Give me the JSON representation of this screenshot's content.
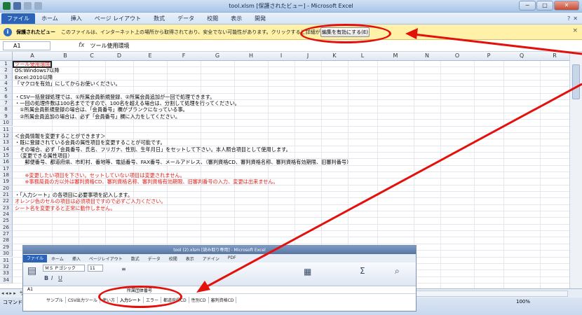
{
  "window": {
    "title": "tool.xlsm [保護されたビュー] - Microsoft Excel",
    "min": "−",
    "max": "□",
    "close": "✕"
  },
  "ribbon": {
    "file_tab": "ファイル",
    "tabs": [
      "ホーム",
      "挿入",
      "ページ レイアウト",
      "数式",
      "データ",
      "校閲",
      "表示",
      "開発"
    ],
    "help": "?",
    "ribbon_close": "✕"
  },
  "message_bar": {
    "label": "保護されたビュー",
    "text": "このファイルは、インターネット上の場所から取得されており、安全でない可能性があります。クリックすると詳細が表示されます。",
    "enable_button": "編集を有効にする(E)",
    "close": "×"
  },
  "formula_bar": {
    "name_box": "A1",
    "fx": "fx",
    "content": "ツール使用環境"
  },
  "columns": [
    "A",
    "B",
    "C",
    "D",
    "E",
    "F",
    "G",
    "H",
    "I",
    "J",
    "K",
    "L",
    "M",
    "N",
    "O",
    "P",
    "Q",
    "R"
  ],
  "rows": [
    {
      "n": "1",
      "text": "ツール使用環境",
      "red": true
    },
    {
      "n": "2",
      "text": "OS:Windows7以降",
      "red": false
    },
    {
      "n": "3",
      "text": "Excel:2010以降",
      "red": false
    },
    {
      "n": "4",
      "text": "「マクロを有効」にしてからお使いください。",
      "red": false
    },
    {
      "n": "5",
      "text": "",
      "red": false
    },
    {
      "n": "6",
      "text": "・CSV一括登録処理では、①所属会員新規登録、②所属会員追加が一回で処理できます。",
      "red": false
    },
    {
      "n": "7",
      "text": "・一回の処理件数は100名までですので、100名を超える場合は、分割して処理を行ってください。",
      "red": false
    },
    {
      "n": "8",
      "text": "　①所属会員新規登録の場合は、「会員番号」欄がブランクになっている事。",
      "red": false
    },
    {
      "n": "9",
      "text": "　②所属会員追加の場合は、必ず「会員番号」欄に入力をしてください。",
      "red": false
    },
    {
      "n": "10",
      "text": "",
      "red": false
    },
    {
      "n": "11",
      "text": "",
      "red": false
    },
    {
      "n": "12",
      "text": "＜会員情報を変更することができます＞",
      "red": false
    },
    {
      "n": "13",
      "text": "・既に登録されている会員の属性項目を変更することが可能です。",
      "red": false
    },
    {
      "n": "14",
      "text": "　その場合、必ず「会員番号、氏名、フリガナ、性別、生年月日」をセットして下さい。本人照合項目として使用します。",
      "red": false
    },
    {
      "n": "15",
      "text": "　（変更できる属性項目）",
      "red": false
    },
    {
      "n": "16",
      "text": "　　郵便番号、都道府県、市町村、番地等、電話番号、FAX番号、メールアドレス、（審判資格CD、審判資格名称、審判資格有効期限、旧審判番号）",
      "red": false
    },
    {
      "n": "17",
      "text": "",
      "red": false
    },
    {
      "n": "18",
      "text": "　　※変更したい項目を下さい。セットしていない項目は変更されません。",
      "red": true
    },
    {
      "n": "19",
      "text": "　　※事務局員の方以外は審判資格CD、審判資格名称、審判資格有効期限、旧審判番号の入力、変更は出来ません。",
      "red": true
    },
    {
      "n": "20",
      "text": "",
      "red": false
    },
    {
      "n": "21",
      "text": "・「入力シート」の各項目に必要事項を記入します。",
      "red": false
    },
    {
      "n": "22",
      "text": "オレンジ色のセルの項目は必須項目ですので必ずご入力ください。",
      "red": true
    },
    {
      "n": "23",
      "text": "シート名を変更すると正常に動作しません。",
      "red": true
    },
    {
      "n": "24",
      "text": "",
      "red": false
    },
    {
      "n": "25",
      "text": "",
      "red": false
    },
    {
      "n": "26",
      "text": "",
      "red": false
    },
    {
      "n": "27",
      "text": "",
      "red": false
    },
    {
      "n": "28",
      "text": "",
      "red": false
    },
    {
      "n": "29",
      "text": "",
      "red": false
    },
    {
      "n": "30",
      "text": "",
      "red": false
    },
    {
      "n": "31",
      "text": "",
      "red": false
    },
    {
      "n": "32",
      "text": "",
      "red": false
    },
    {
      "n": "33",
      "text": "",
      "red": false
    },
    {
      "n": "34",
      "text": "",
      "red": false
    }
  ],
  "sheet_tabs": {
    "nav": "◂ ◂ ▸ ▸",
    "items": [
      {
        "label": "サンプル",
        "active": false
      },
      {
        "label": "CSV出力ツール",
        "active": false
      },
      {
        "label": "使い方",
        "active": false
      },
      {
        "label": "入力シート",
        "active": true
      },
      {
        "label": "エラー",
        "active": false
      },
      {
        "label": "都道府県CD",
        "active": false
      },
      {
        "label": "性別CD",
        "active": false
      },
      {
        "label": "審判資格CD",
        "active": false
      }
    ]
  },
  "status_bar": {
    "mode": "コマンド",
    "zoom": "100%"
  },
  "inset": {
    "title": "tool (2).xlsm [読み取り専用] - Microsoft Excel",
    "file_tab": "ファイル",
    "tabs": [
      "ホーム",
      "挿入",
      "ページレイアウト",
      "数式",
      "データ",
      "校閲",
      "表示",
      "アドイン",
      "PDF"
    ],
    "font": "ＭＳ Ｐゴシック",
    "size": "11",
    "name_box": "A1",
    "cell_value": "所属団体番号",
    "sheet_tabs": [
      "サンプル",
      "CSV出力ツール",
      "使い方",
      "入力シート",
      "エラー",
      "都道府県CD",
      "性別CD",
      "審判資格CD"
    ]
  },
  "colors": {
    "annotation": "#e3100c",
    "message_bar": "#fff2a8",
    "red_text": "#e0201a",
    "file_tab": "#2a63b8"
  }
}
